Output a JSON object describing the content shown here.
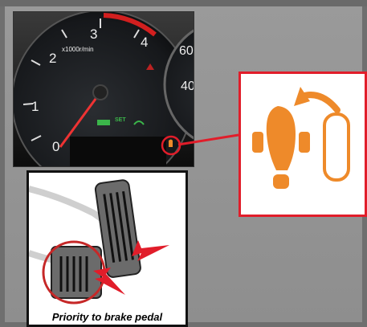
{
  "cluster": {
    "tach_ticks": [
      "0",
      "1",
      "2",
      "3",
      "4"
    ],
    "tach_unit": "x1000r/min",
    "speedo_ticks": [
      "60",
      "40"
    ],
    "indicator_text": "SET"
  },
  "callout": {
    "icon": "brake-override-icon",
    "accent": "#ee8a2a",
    "border_color": "#e11d2a"
  },
  "pedals": {
    "caption": "Priority to brake pedal",
    "arrow_color": "#e11d2a"
  }
}
